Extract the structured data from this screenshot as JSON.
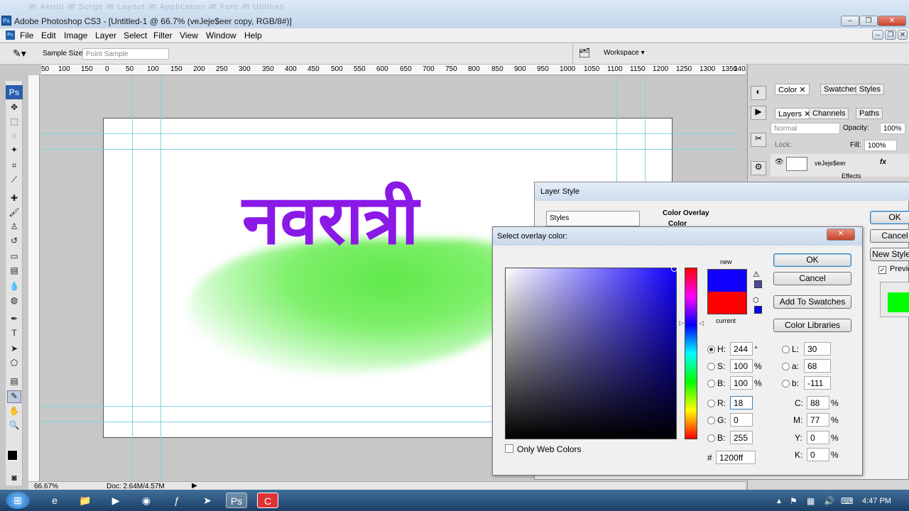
{
  "window": {
    "title": "Adobe Photoshop CS3 - [Untitled-1 @ 66.7% (veJeje$eer copy, RGB/8#)]",
    "app_icon": "Ps",
    "buttons": {
      "minimize": "–",
      "restore": "❐",
      "close": "✕"
    }
  },
  "menu": [
    "File",
    "Edit",
    "Image",
    "Layer",
    "Select",
    "Filter",
    "View",
    "Window",
    "Help"
  ],
  "options_bar": {
    "sample_size_label": "Sample Size:",
    "sample_size_value": "Point Sample",
    "workspace_label": "Workspace ▾"
  },
  "ruler_ticks": [
    "50",
    "100",
    "150",
    "0",
    "50",
    "100",
    "150",
    "200",
    "250",
    "300",
    "350",
    "400",
    "450",
    "500",
    "550",
    "600",
    "650",
    "700",
    "750",
    "800",
    "850",
    "900",
    "950",
    "1000",
    "1050",
    "1100",
    "1150",
    "1200",
    "1250",
    "1300",
    "1350",
    "140"
  ],
  "canvas": {
    "title_text": "नवरात्री",
    "text_color": "#8a19e6",
    "smear_color": "#5fe84a"
  },
  "status": {
    "zoom": "66.67%",
    "doc": "Doc: 2.64M/4.57M"
  },
  "panels": {
    "tabs_top": [
      "Color",
      "Swatches",
      "Styles"
    ],
    "tabs_layers": [
      "Layers",
      "Channels",
      "Paths"
    ],
    "blend_mode": "Normal",
    "opacity_label": "Opacity:",
    "opacity_value": "100%",
    "lock_label": "Lock:",
    "fill_label": "Fill:",
    "fill_value": "100%",
    "layer_name": "veJeje$eer",
    "effects_label": "Effects",
    "fx_label": "fx"
  },
  "layer_style": {
    "title": "Layer Style",
    "styles_label": "Styles",
    "section": "Color Overlay",
    "subsection": "Color",
    "ok": "OK",
    "cancel": "Cancel",
    "new_style": "New Style...",
    "preview": "Preview",
    "preview_color": "#00ff00"
  },
  "picker": {
    "title": "Select overlay color:",
    "ok": "OK",
    "cancel": "Cancel",
    "add_to_swatches": "Add To Swatches",
    "color_libraries": "Color Libraries",
    "new_label": "new",
    "current_label": "current",
    "new_color": "#1200ff",
    "current_color": "#ff0000",
    "only_web": "Only Web Colors",
    "fields": {
      "H": {
        "label": "H:",
        "value": "244",
        "unit": "°"
      },
      "S": {
        "label": "S:",
        "value": "100",
        "unit": "%"
      },
      "B": {
        "label": "B:",
        "value": "100",
        "unit": "%"
      },
      "R": {
        "label": "R:",
        "value": "18"
      },
      "G": {
        "label": "G:",
        "value": "0"
      },
      "Bb": {
        "label": "B:",
        "value": "255"
      },
      "L": {
        "label": "L:",
        "value": "30"
      },
      "a": {
        "label": "a:",
        "value": "68"
      },
      "b": {
        "label": "b:",
        "value": "-111"
      },
      "C": {
        "label": "C:",
        "value": "88",
        "unit": "%"
      },
      "M": {
        "label": "M:",
        "value": "77",
        "unit": "%"
      },
      "Y": {
        "label": "Y:",
        "value": "0",
        "unit": "%"
      },
      "K": {
        "label": "K:",
        "value": "0",
        "unit": "%"
      }
    },
    "hex_label": "#",
    "hex_value": "1200ff"
  },
  "taskbar": {
    "time": "4:47 PM"
  }
}
